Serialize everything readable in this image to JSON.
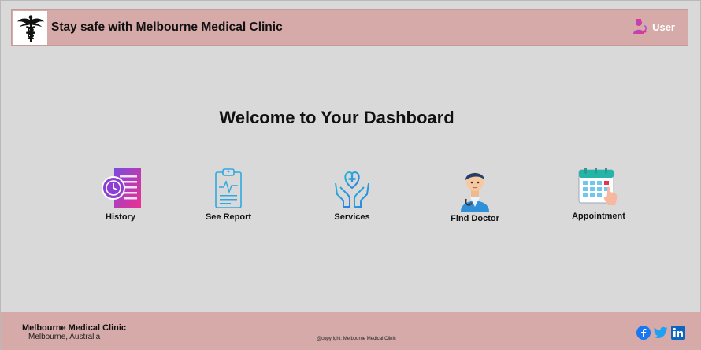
{
  "header": {
    "title": "Stay safe with Melbourne Medical Clinic",
    "logo_icon": "caduceus-icon",
    "user_icon": "doctor-user-icon",
    "user_label": "User"
  },
  "main": {
    "welcome": "Welcome to Your Dashboard",
    "tiles": [
      {
        "label": "History",
        "icon": "history-clock-icon"
      },
      {
        "label": "See Report",
        "icon": "clipboard-report-icon"
      },
      {
        "label": "Services",
        "icon": "hands-heart-icon"
      },
      {
        "label": "Find Doctor",
        "icon": "doctor-avatar-icon"
      },
      {
        "label": "Appointment",
        "icon": "calendar-icon"
      }
    ]
  },
  "footer": {
    "clinic_name": "Melbourne Medical Clinic",
    "location": "Melbourne, Australia",
    "copyright": "@copyright: Melbourne Medical Clinic",
    "social": [
      "facebook-icon",
      "twitter-icon",
      "linkedin-icon"
    ]
  },
  "colors": {
    "header_bg": "#d7aaaa",
    "page_bg": "#d9d9d9",
    "footer_bg": "#d7aaaa",
    "facebook": "#1877f2",
    "twitter": "#1da1f2",
    "linkedin": "#0a66c2"
  }
}
